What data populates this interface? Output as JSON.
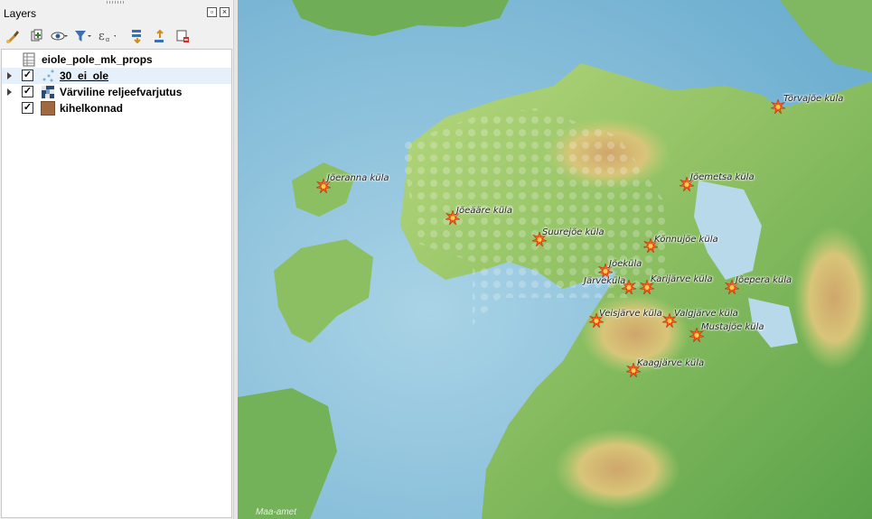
{
  "panel": {
    "title": "Layers",
    "float_label": "▫",
    "close_label": "×"
  },
  "toolbar": {
    "buttons": [
      "style-brush-icon",
      "add-group-icon",
      "visibility-eye-icon",
      "filter-icon",
      "expression-filter-icon",
      "expand-all-icon",
      "collapse-all-icon",
      "remove-layer-icon"
    ]
  },
  "layers": [
    {
      "name": "eiole_pole_mk_props",
      "checked": false,
      "expandable": false,
      "icon": "table-icon"
    },
    {
      "name": "30_ei_ole",
      "checked": true,
      "expandable": true,
      "icon": "point-layer-icon",
      "selected": true
    },
    {
      "name": "Värviline reljeefvarjutus",
      "checked": true,
      "expandable": true,
      "icon": "raster-icon"
    },
    {
      "name": "kihelkonnad",
      "checked": true,
      "expandable": false,
      "icon": "polygon-fill-icon",
      "fill": "#a0693f"
    }
  ],
  "map": {
    "places": [
      {
        "name": "Tõrvajõe küla"
      },
      {
        "name": "Jõeranna küla"
      },
      {
        "name": "Jõemetsa küla"
      },
      {
        "name": "Jõeääre küla"
      },
      {
        "name": "Suurejõe küla"
      },
      {
        "name": "Kõnnujõe küla"
      },
      {
        "name": "Jõeküla"
      },
      {
        "name": "Järveküla"
      },
      {
        "name": "Karijärve küla"
      },
      {
        "name": "Jõepera küla"
      },
      {
        "name": "Veisjärve küla"
      },
      {
        "name": "Valgjärve küla"
      },
      {
        "name": "Mustajõe küla"
      },
      {
        "name": "Kaagjärve küla"
      }
    ],
    "attribution": "Maa-amet",
    "colors": {
      "sea": "#8ec3dc",
      "lowland": "#9cc76a",
      "upland": "#d9c27a",
      "marker": "#ff5a1f"
    }
  }
}
